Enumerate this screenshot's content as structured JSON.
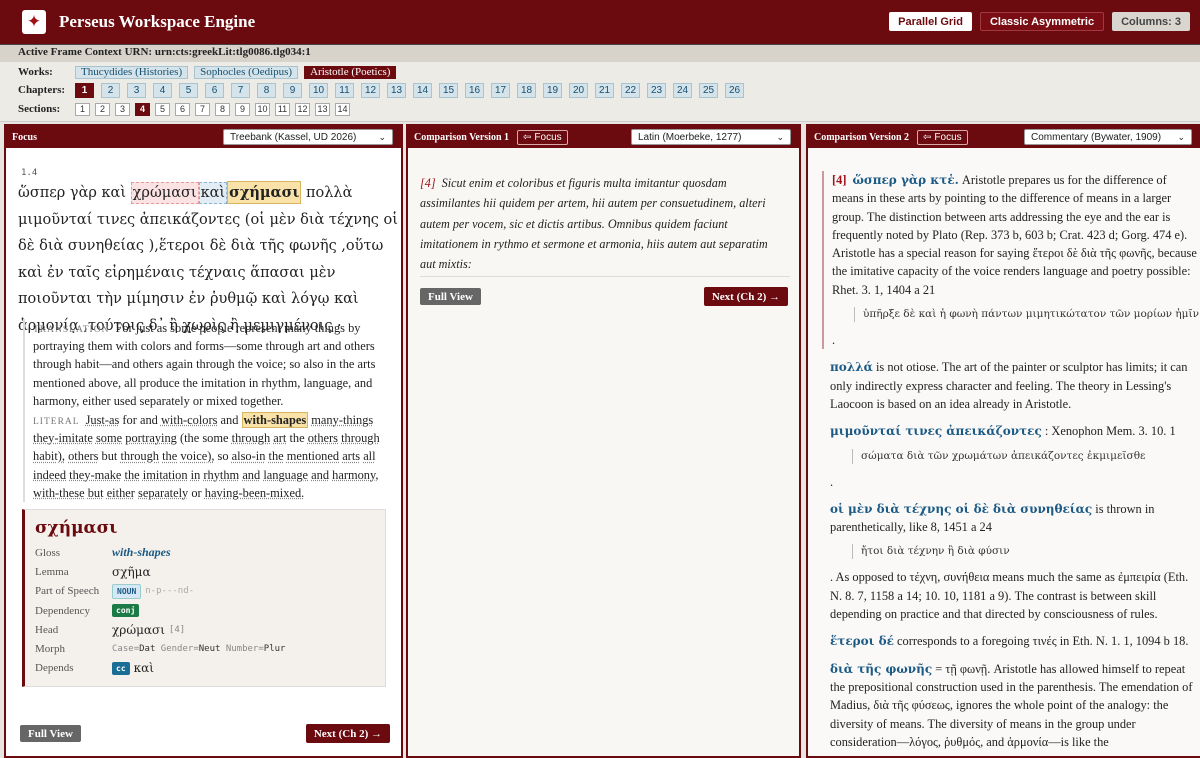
{
  "app": {
    "title": "Perseus Workspace Engine",
    "logo": "reader-logo-icon"
  },
  "layout_buttons": {
    "parallel": "Parallel Grid",
    "asymmetric": "Classic Asymmetric",
    "columns": "Columns: 3"
  },
  "urn": "Active Frame Context URN: urn:cts:greekLit:tlg0086.tlg034:1",
  "nav": {
    "works_label": "Works:",
    "chapters_label": "Chapters:",
    "sections_label": "Sections:",
    "works": [
      "Thucydides (Histories)",
      "Sophocles (Oedipus)",
      "Aristotle (Poetics)"
    ],
    "active_work": "Aristotle (Poetics)",
    "chapters": [
      "1",
      "2",
      "3",
      "4",
      "5",
      "6",
      "7",
      "8",
      "9",
      "10",
      "11",
      "12",
      "13",
      "14",
      "15",
      "16",
      "17",
      "18",
      "19",
      "20",
      "21",
      "22",
      "23",
      "24",
      "25",
      "26"
    ],
    "active_chapter": "1",
    "sections": [
      "1",
      "2",
      "3",
      "4",
      "5",
      "6",
      "7",
      "8",
      "9",
      "10",
      "11",
      "12",
      "13",
      "14"
    ],
    "active_section": "4"
  },
  "focus": {
    "title": "Focus",
    "edition": "Treebank (Kassel, UD 2026)",
    "ref": "1.4",
    "tokens": {
      "t1": "ὥσπερ γὰρ καὶ ",
      "t2": "χρώμασι",
      "t3": "καὶ",
      "t4": "σχήμασι",
      "t5": " πολλὰ μιμοῦνταί τινες ἀπεικάζοντες (οἱ μὲν διὰ τέχνης οἱ δὲ διὰ συνηθείας ),ἕτεροι δὲ διὰ τῆς φωνῆς ,οὕτω καὶ ἐν ταῖς εἰρημέναις τέχναις ἅπασαι μὲν ποιοῦνται τὴν μίμησιν ἐν ῥυθμῷ καὶ λόγῳ καὶ ἁρμονίᾳ ,τούτοις δ᾽ ἢ χωρὶς ἢ μεμιγμένοις ·"
    },
    "translation_label": "TRANSLATION",
    "translation": "For just as some people represent many things by portraying them with colors and forms—some through art and others through habit—and others again through the voice; so also in the arts mentioned above, all produce the imitation in rhythm, language, and harmony, either used separately or mixed together.",
    "literal_label": "LITERAL",
    "literal": {
      "a": "Just-as",
      "b": "for",
      "c": "and",
      "d": "with-colors",
      "e": "and",
      "f": "with-shapes",
      "g": "many-things",
      "h": "they-imitate",
      "i": "some",
      "j": "portraying",
      "k": "(the",
      "l": "some",
      "m": "through",
      "n": "art",
      "o": "the",
      "p": "others",
      "q": "through",
      "r": "habit),",
      "s": "others",
      "t": "but",
      "u": "through",
      "v": "the",
      "w": "voice),",
      "x": "so",
      "y": "also-in",
      "z": "the",
      "aa": "mentioned",
      "ab": "arts",
      "ac": "all",
      "ad": "indeed",
      "ae": "they-make",
      "af": "the",
      "ag": "imitation",
      "ah": "in",
      "ai": "rhythm",
      "aj": "and",
      "ak": "language",
      "al": "and",
      "am": "harmony,",
      "an": "with-these",
      "ao": "but",
      "ap": "either",
      "aq": "separately",
      "ar": "or",
      "as": "having-been-mixed."
    },
    "card": {
      "word": "σχήμασι",
      "gloss_k": "Gloss",
      "gloss": "with-shapes",
      "lemma_k": "Lemma",
      "lemma": "σχῆμα",
      "pos_k": "Part of Speech",
      "pos_tag": "NOUN",
      "pos_code": "n-p---nd-",
      "dep_k": "Dependency",
      "dep": "conj",
      "head_k": "Head",
      "head": "χρώμασι",
      "head_idx": "[4]",
      "morph_k": "Morph",
      "m1k": "Case",
      "m1v": "Dat",
      "m2k": "Gender",
      "m2v": "Neut",
      "m3k": "Number",
      "m3v": "Plur",
      "depends_k": "Depends",
      "depends_tag": "cc",
      "depends_word": "καὶ"
    },
    "full_view": "Full View",
    "next": "Next (Ch 2) →"
  },
  "comp1": {
    "title": "Comparison Version 1",
    "focus_btn": "Focus",
    "edition": "Latin (Moerbeke, 1277)",
    "section": "[4]",
    "text": "Sicut enim et coloribus et figuris multa imitantur quosdam assimilantes hii quidem per artem, hii autem per consuetudinem, alteri autem per vocem, sic et dictis artibus. Omnibus quidem faciunt imitationem in rythmo et sermone et armonia, hiis autem aut separatim aut mixtis:",
    "full_view": "Full View",
    "next": "Next (Ch 2) →"
  },
  "comp2": {
    "title": "Comparison Version 2",
    "focus_btn": "Focus",
    "edition": "Commentary (Bywater, 1909)",
    "section": "[4]",
    "e1_lemma": "ὥσπερ γὰρ κτἑ.",
    "e1_text": " Aristotle prepares us for the difference of means in these arts by pointing to the difference of means in a larger group. The distinction between arts addressing the eye and the ear is frequently noted by Plato (Rep. 373 b, 603 b; Crat. 423 d; Gorg. 474 e). Aristotle has a special reason for saying ἕτεροι δὲ διὰ τῆς φωνῆς, because the imitative capacity of the voice renders language and poetry possible: Rhet. 3. 1, 1404 a 21",
    "e1_quote": "ὑπῆρξε δὲ καὶ ἡ φωνὴ πάντων μιμητικώτατον τῶν μορίων ἡμῖν",
    "e1_tail": ".",
    "e2_lemma": "πολλά",
    "e2_text": " is not otiose. The art of the painter or sculptor has limits; it can only indirectly express character and feeling. The theory in Lessing's Laocoon is based on an idea already in Aristotle.",
    "e3_lemma": "μιμοῦνταί τινες ἀπεικάζοντες",
    "e3_text": " : Xenophon Mem. 3. 10. 1",
    "e3_quote": "σώματα διὰ τῶν χρωμάτων ἀπεικάζοντες ἐκμιμεῖσθε",
    "e3_tail": ".",
    "e4_lemma": "οἱ μὲν διὰ τέχνης οἱ δὲ διὰ συνηθείας",
    "e4_text": " is thrown in parenthetically, like 8, 1451 a 24",
    "e4_quote": "ἤτοι διὰ τέχνην ἢ διὰ φύσιν",
    "e4_tail": ". As opposed to τέχνη, συνήθεια means much the same as ἐμπειρία (Eth. N. 8. 7, 1158 a 14; 10. 10, 1181 a 9). The contrast is between skill depending on practice and that directed by consciousness of rules.",
    "e5_lemma": "ἕτεροι δέ",
    "e5_text": " corresponds to a foregoing τινές in Eth. N. 1. 1, 1094 b 18.",
    "e6_lemma": "διὰ τῆς φωνῆς",
    "e6_text": " = τῇ φωνῇ. Aristotle has allowed himself to repeat the prepositional construction used in the parenthesis. The emendation of Madius, διὰ τῆς φύσεως, ignores the whole point of the analogy: the diversity of means. The diversity of means in the group under consideration—λόγος, ῥυθμός, and ἁρμονία—is like the"
  }
}
